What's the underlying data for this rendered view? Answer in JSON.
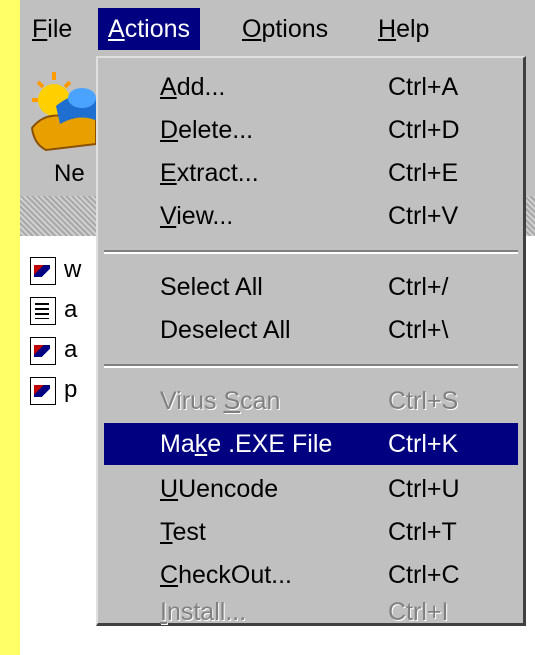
{
  "menubar": {
    "items": [
      {
        "label": "File",
        "accel": "F",
        "rest": "ile"
      },
      {
        "label": "Actions",
        "accel": "A",
        "rest": "ctions"
      },
      {
        "label": "Options",
        "accel": "O",
        "rest": "ptions"
      },
      {
        "label": "Help",
        "accel": "H",
        "rest": "elp"
      }
    ]
  },
  "toolbar": {
    "new_label": "Ne"
  },
  "files": [
    {
      "icon": "image-file-icon",
      "name": "w"
    },
    {
      "icon": "text-file-icon",
      "name": "a"
    },
    {
      "icon": "image-file-icon",
      "name": "a"
    },
    {
      "icon": "image-file-icon",
      "name": "p"
    }
  ],
  "actions_menu": {
    "add": {
      "pre": "",
      "accel": "A",
      "post": "dd...",
      "shortcut": "Ctrl+A"
    },
    "delete": {
      "pre": "",
      "accel": "D",
      "post": "elete...",
      "shortcut": "Ctrl+D"
    },
    "extract": {
      "pre": "",
      "accel": "E",
      "post": "xtract...",
      "shortcut": "Ctrl+E"
    },
    "view": {
      "pre": "",
      "accel": "V",
      "post": "iew...",
      "shortcut": "Ctrl+V"
    },
    "select_all": {
      "label": "Select All",
      "shortcut": "Ctrl+/"
    },
    "deselect_all": {
      "label": "Deselect All",
      "shortcut": "Ctrl+\\"
    },
    "virus_scan": {
      "pre": "Virus ",
      "accel": "S",
      "post": "can",
      "shortcut": "Ctrl+S"
    },
    "make_exe": {
      "pre": "Ma",
      "accel": "k",
      "post": "e .EXE File",
      "shortcut": "Ctrl+K"
    },
    "uuencode": {
      "pre": "",
      "accel": "U",
      "post": "Uencode",
      "shortcut": "Ctrl+U"
    },
    "test": {
      "pre": "",
      "accel": "T",
      "post": "est",
      "shortcut": "Ctrl+T"
    },
    "checkout": {
      "pre": "",
      "accel": "C",
      "post": "heckOut...",
      "shortcut": "Ctrl+C"
    },
    "install": {
      "pre": "",
      "accel": "I",
      "post": "nstall...",
      "shortcut": "Ctrl+I"
    }
  },
  "colors": {
    "menu_bg": "#c0c0c0",
    "highlight": "#000080",
    "page_bg": "#ffff66",
    "disabled": "#808080"
  }
}
